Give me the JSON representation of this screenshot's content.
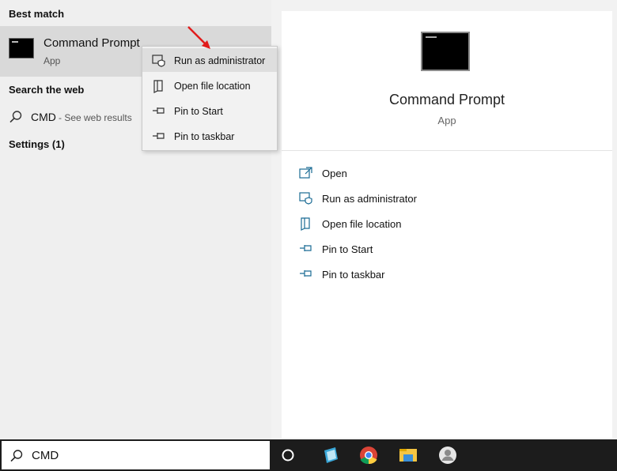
{
  "left": {
    "best_match_heading": "Best match",
    "best_match_item": {
      "title": "Command Prompt",
      "subtitle": "App"
    },
    "search_web_heading": "Search the web",
    "web_result": {
      "term": "CMD",
      "suffix": "- See web results"
    },
    "settings_heading": "Settings (1)"
  },
  "context_menu": {
    "items": [
      {
        "label": "Run as administrator",
        "icon": "admin-shield-icon",
        "highlighted": true
      },
      {
        "label": "Open file location",
        "icon": "file-location-icon"
      },
      {
        "label": "Pin to Start",
        "icon": "pin-icon"
      },
      {
        "label": "Pin to taskbar",
        "icon": "pin-icon"
      }
    ]
  },
  "preview": {
    "title": "Command Prompt",
    "subtitle": "App",
    "actions": [
      {
        "label": "Open",
        "icon": "open-icon"
      },
      {
        "label": "Run as administrator",
        "icon": "admin-shield-icon"
      },
      {
        "label": "Open file location",
        "icon": "file-location-icon"
      },
      {
        "label": "Pin to Start",
        "icon": "pin-icon"
      },
      {
        "label": "Pin to taskbar",
        "icon": "pin-icon"
      }
    ]
  },
  "taskbar": {
    "search_value": "CMD",
    "apps": [
      "cortana-icon",
      "notepad-icon",
      "chrome-icon",
      "file-explorer-icon",
      "user-avatar-icon"
    ]
  },
  "colors": {
    "accent": "#1a6b94",
    "highlight": "#d9d9d9",
    "taskbar": "#1c1c1c",
    "arrow": "#e11b1b"
  }
}
